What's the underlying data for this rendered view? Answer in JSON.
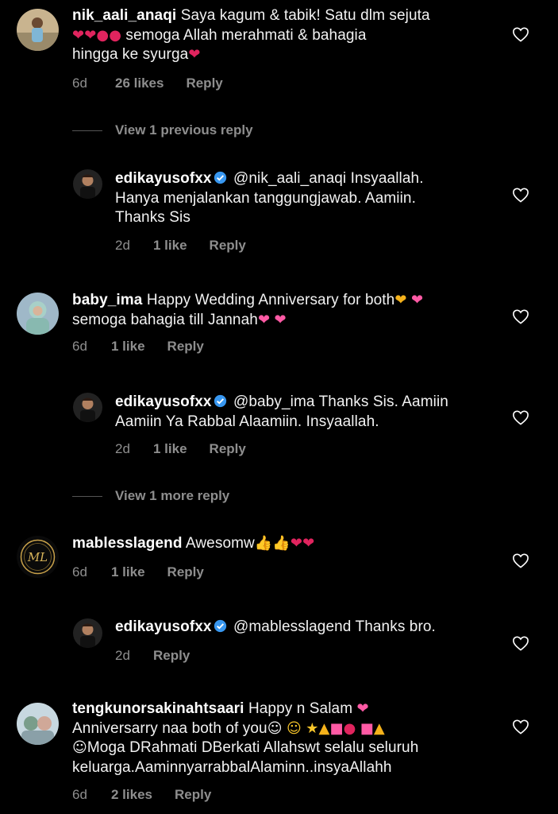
{
  "comments": [
    {
      "user": "nik_aali_anaqi",
      "text_l1": "Saya kagum & tabik! Satu dlm sejuta",
      "text_l2": "semoga Allah merahmati & bahagia",
      "text_l3": "hingga ke syurga",
      "time": "6d",
      "likes": "26 likes",
      "reply": "Reply"
    },
    {
      "user": "edikayusofxx",
      "text_l1": "@nik_aali_anaqi Insyaallah.",
      "text_l2": "Hanya menjalankan tanggungjawab. Aamiin.",
      "text_l3": "Thanks Sis",
      "time": "2d",
      "likes": "1 like",
      "reply": "Reply"
    },
    {
      "user": "baby_ima",
      "text_l1": "Happy Wedding Anniversary for both",
      "text_l2": "semoga bahagia till Jannah",
      "time": "6d",
      "likes": "1 like",
      "reply": "Reply"
    },
    {
      "user": "edikayusofxx",
      "text_l1": "@baby_ima Thanks Sis. Aamiin",
      "text_l2": "Aamiin Ya Rabbal Alaamiin. Insyaallah.",
      "time": "2d",
      "likes": "1 like",
      "reply": "Reply"
    },
    {
      "user": "mablesslagend",
      "text_l1": "Awesomw",
      "avatar_text": "ML",
      "time": "6d",
      "likes": "1 like",
      "reply": "Reply"
    },
    {
      "user": "edikayusofxx",
      "text_l1": "@mablesslagend Thanks bro.",
      "time": "2d",
      "reply": "Reply"
    },
    {
      "user": "tengkunorsakinahtsaari",
      "text_l1": "Happy n Salam",
      "text_l2": "Anniversarry naa both of you",
      "text_l3": "Moga DRahmati DBerkati Allahswt selalu seluruh",
      "text_l4": "keluarga.AaminnyarrabbalAlaminn..insyaAllahh",
      "time": "6d",
      "likes": "2 likes",
      "reply": "Reply"
    }
  ],
  "view_replies": [
    "View 1 previous reply",
    "View 1 more reply"
  ],
  "icons": {
    "heart": "heart-outline-icon",
    "verified": "verified-badge-icon"
  },
  "colors": {
    "background": "#000000",
    "muted": "#8e8e8e",
    "verified": "#3897f0",
    "heart_emoji": "#e0245e"
  }
}
